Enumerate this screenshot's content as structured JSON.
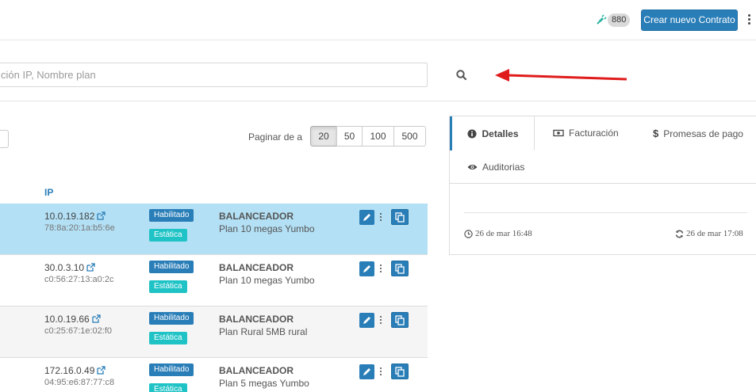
{
  "header": {
    "connections_count": "880",
    "create_button_label": "Crear nuevo Contrato",
    "icons": {
      "plug": "plug-icon",
      "more": "kebab-icon"
    },
    "accent_color": "#2a7eb8"
  },
  "search": {
    "placeholder": "ción IP, Nombre plan",
    "value": "",
    "icon": "search-icon"
  },
  "pagination": {
    "label": "Paginar de a",
    "options": [
      "20",
      "50",
      "100",
      "500"
    ],
    "active": "20"
  },
  "table": {
    "ip_header": "IP",
    "rows": [
      {
        "ip": "10.0.19.182",
        "mac": "78:8a:20:1a:b5:6e",
        "status": "Habilitado",
        "type": "Estática",
        "plan_title": "BALANCEADOR",
        "plan_name": "Plan 10 megas Yumbo",
        "selected": true
      },
      {
        "ip": "30.0.3.10",
        "mac": "c0:56:27:13:a0:2c",
        "status": "Habilitado",
        "type": "Estática",
        "plan_title": "BALANCEADOR",
        "plan_name": "Plan 10 megas Yumbo",
        "selected": false
      },
      {
        "ip": "10.0.19.66",
        "mac": "c0:25:67:1e:02:f0",
        "status": "Habilitado",
        "type": "Estática",
        "plan_title": "BALANCEADOR",
        "plan_name": "Plan Rural 5MB rural",
        "selected": false
      },
      {
        "ip": "172.16.0.49",
        "mac": "04:95:e6:87:77:c8",
        "status": "Habilitado",
        "type": "Estática",
        "plan_title": "BALANCEADOR",
        "plan_name": "Plan 5 megas Yumbo",
        "selected": false
      }
    ]
  },
  "details_panel": {
    "tabs": [
      {
        "label": "Detalles",
        "icon": "info-circle-icon",
        "active": true
      },
      {
        "label": "Facturación",
        "icon": "money-bill-icon",
        "active": false
      },
      {
        "label": "Promesas de pago",
        "icon": "dollar-icon",
        "active": false
      },
      {
        "label": "Auditorias",
        "icon": "eye-icon",
        "active": false
      }
    ],
    "created": "26 de mar 16:48",
    "updated": "26 de mar 17:08"
  },
  "status_colors": {
    "habilitado": "#2a7eb8",
    "estatica": "#1fc3c6",
    "selected_row": "#b3e0f5"
  }
}
